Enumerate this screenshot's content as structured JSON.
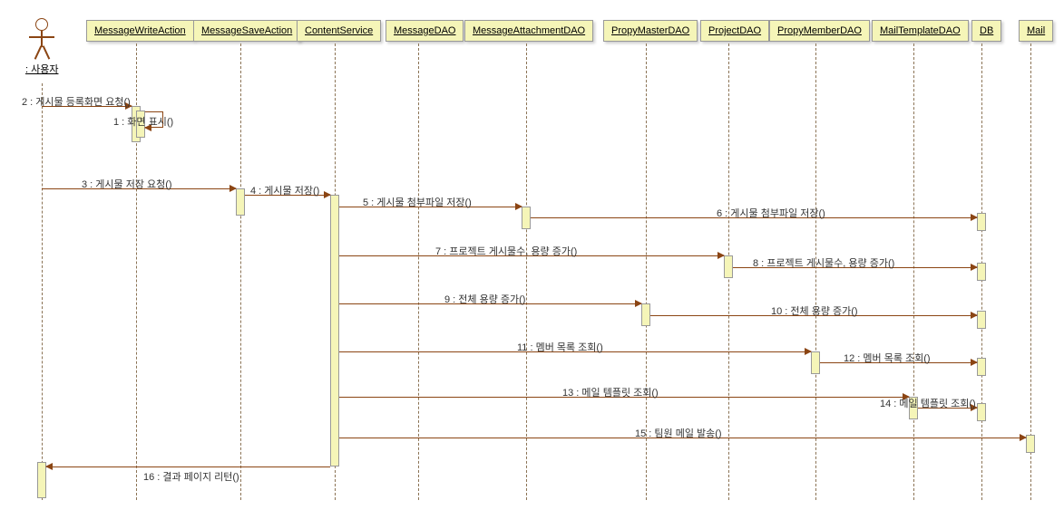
{
  "actor": {
    "label": ": 사용자"
  },
  "lifelines": {
    "l1": "MessageWriteAction",
    "l2": "MessageSaveAction",
    "l3": "ContentService",
    "l4": "MessageDAO",
    "l5": "MessageAttachmentDAO",
    "l6": "PropyMasterDAO",
    "l7": "ProjectDAO",
    "l8": "PropyMemberDAO",
    "l9": "MailTemplateDAO",
    "l10": "DB",
    "l11": "Mail"
  },
  "messages": {
    "m2": "2 : 게시물 등록화면 요청()",
    "m2b": "1 : 화면 표시()",
    "m3": "3 : 게시물 저장 요청()",
    "m4": "4 : 게시물 저장()",
    "m5": "5 : 게시물 첨부파일 저장()",
    "m6": "6 : 게시물 첨부파일 저장()",
    "m7": "7 : 프로젝트 게시물수, 용량 증가()",
    "m8": "8 : 프로젝트 게시물수, 용량 증가()",
    "m9": "9 : 전체 용량 증가()",
    "m10": "10 : 전체 용량 증가()",
    "m11": "11 : 멤버 목록 조회()",
    "m12": "12 : 멤버 목록 조회()",
    "m13": "13 : 메일 템플릿 조회()",
    "m14": "14 : 메일 템플릿 조회()",
    "m15": "15 : 팀원 메일 발송()",
    "m16": "16 : 결과 페이지 리턴()"
  }
}
